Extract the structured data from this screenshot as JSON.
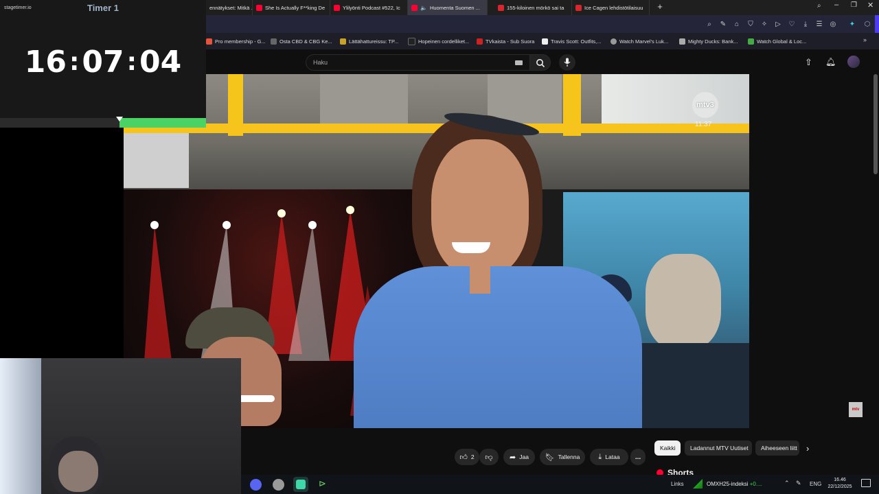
{
  "timer": {
    "logo": "stagetimer.io",
    "title": "Timer 1",
    "hours": "16",
    "minutes": "07",
    "seconds": "04",
    "sep": ":",
    "progress_fraction": 0.42,
    "progress_color": "#4ad264"
  },
  "tabs": [
    {
      "label": "ennätykset: Mitkä ...",
      "color": "#888888"
    },
    {
      "label": "She Is Actually F**king De",
      "color": "#ff0033"
    },
    {
      "label": "Ylilyönti Podcast #522, Ic",
      "color": "#ff0033"
    },
    {
      "label": "Huomenta Suomen ...",
      "color": "#ff0033",
      "active": true
    },
    {
      "label": "155-kiloinen mörkö sai ta",
      "color": "#d9262c"
    },
    {
      "label": "Ice Cagen lehdistötilaisuu",
      "color": "#d9262c"
    }
  ],
  "new_tab": "+",
  "bookmarks": [
    {
      "label": "Pro membership - G...",
      "color": "#e5533b"
    },
    {
      "label": "Osta CBD & CBG Ke...",
      "color": "#666666"
    },
    {
      "label": "Lättähattureissu: TP...",
      "color": "#c9a227"
    },
    {
      "label": "Hopeinen cordelliket...",
      "color": "#222222"
    },
    {
      "label": "TVkaista - Sub Suora",
      "color": "#c22"
    },
    {
      "label": "Travis Scott: Outfits,...",
      "color": "#eeeeee"
    },
    {
      "label": "Watch Marvel's Luk...",
      "color": "#999999"
    },
    {
      "label": "Mighty Ducks: Bank...",
      "color": "#aaaaaa"
    },
    {
      "label": "Watch Global & Loc...",
      "color": "#4a4"
    }
  ],
  "youtube": {
    "search_placeholder": "Haku"
  },
  "video": {
    "channel_logo": "mtv3",
    "time": "11:37",
    "corner_badge": "mtv"
  },
  "actions": {
    "like_count": "2",
    "share": "Jaa",
    "save": "Tallenna",
    "download": "Lataa",
    "more": "..."
  },
  "chips": [
    "Kaikki",
    "Ladannut MTV Uutiset",
    "Aiheeseen liitt"
  ],
  "shorts": "Shorts",
  "taskbar": {
    "links": "Links",
    "stock": "OMXH25-indeksi",
    "stock_change": "+0....",
    "lang": "ENG",
    "time": "16.46",
    "date": "22/12/2025"
  }
}
